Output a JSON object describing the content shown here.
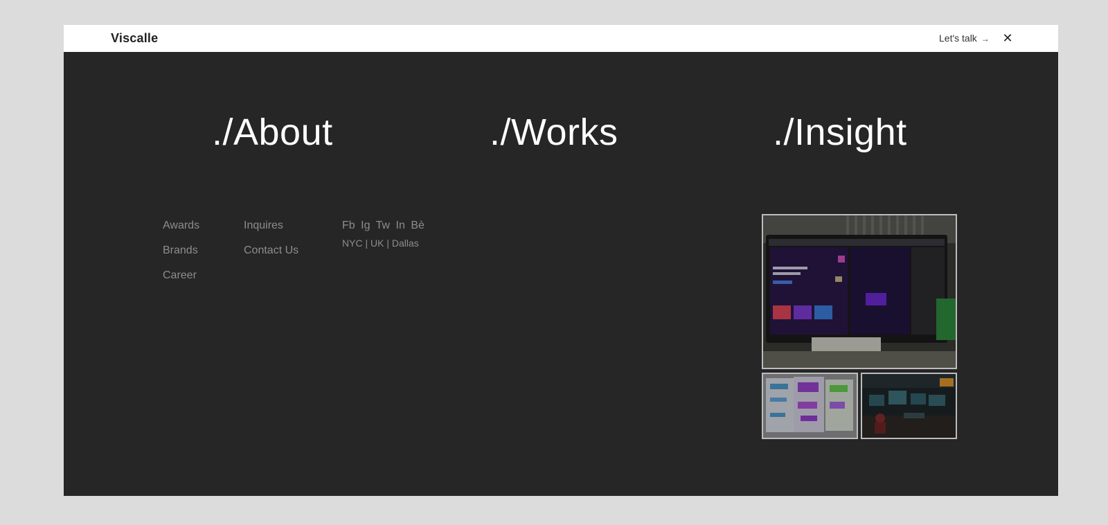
{
  "header": {
    "brand": "Viscalle",
    "cta_label": "Let's talk",
    "cta_arrow": "→",
    "close_symbol": "✕"
  },
  "nav": [
    {
      "label": "./About"
    },
    {
      "label": "./Works"
    },
    {
      "label": "./Insight"
    }
  ],
  "footer": {
    "col1": [
      "Awards",
      "Brands",
      "Career"
    ],
    "col2": [
      "Inquires",
      "Contact Us"
    ],
    "social": [
      "Fb",
      "Ig",
      "Tw",
      "In",
      "Bè"
    ],
    "locations": "NYC | UK | Dallas"
  },
  "colors": {
    "background": "#262626",
    "topbar": "#ffffff",
    "page": "#dcdcdc",
    "nav_text": "#ffffff",
    "muted_text": "#8d8d8d"
  }
}
